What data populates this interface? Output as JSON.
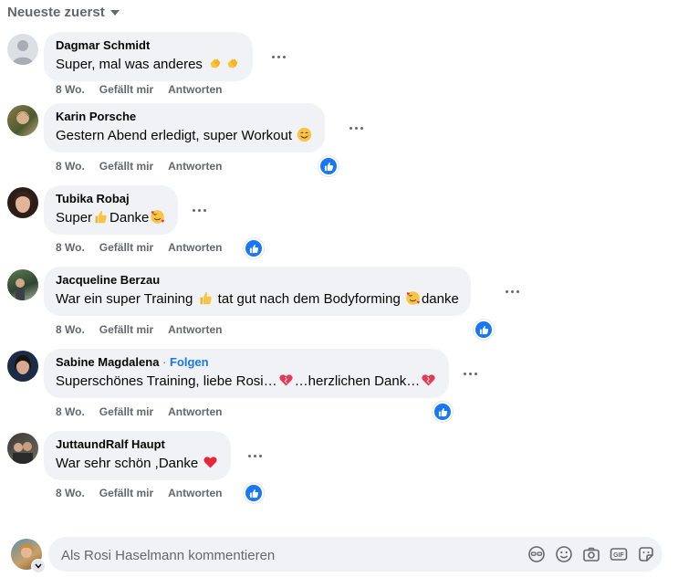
{
  "sort": {
    "label": "Neueste zuerst"
  },
  "actions": {
    "time": "8 Wo.",
    "like": "Gefällt mir",
    "reply": "Antworten"
  },
  "comments": [
    {
      "author": "Dagmar Schmidt",
      "parts": [
        "Super, mal was anderes ",
        ""
      ],
      "emoji": [
        "clap-emoji",
        "clap-emoji"
      ],
      "liked": false
    },
    {
      "author": "Karin Porsche",
      "parts": [
        "Gestern Abend erledigt, super Workout ",
        ""
      ],
      "emoji": [
        "smile-emoji"
      ],
      "liked": true
    },
    {
      "author": "Tubika Robaj",
      "parts": [
        "Super",
        "Danke",
        ""
      ],
      "emoji": [
        "thumbs-up-emoji",
        "smiling-hearts-emoji"
      ],
      "liked": true
    },
    {
      "author": "Jacqueline Berzau",
      "parts": [
        "War ein super Training ",
        " tat gut nach dem Bodyforming ",
        "danke"
      ],
      "emoji": [
        "thumbs-up-emoji",
        "smiling-hearts-emoji"
      ],
      "liked": true
    },
    {
      "author": "Sabine Magdalena",
      "follow": "Folgen",
      "parts": [
        "Superschönes Training, liebe Rosi…",
        "…herzlichen Dank…",
        ""
      ],
      "emoji": [
        "heart-emoji",
        "heart-emoji"
      ],
      "liked": true
    },
    {
      "author": "JuttaundRalf Haupt",
      "parts": [
        "War sehr schön ,Danke ",
        ""
      ],
      "emoji": [
        "red-heart-emoji"
      ],
      "liked": true
    }
  ],
  "composer": {
    "placeholder": "Als Rosi Haselmann kommentieren"
  },
  "colors": {
    "accent": "#1877f2",
    "bubble": "#f0f2f5",
    "muted": "#65676b"
  }
}
